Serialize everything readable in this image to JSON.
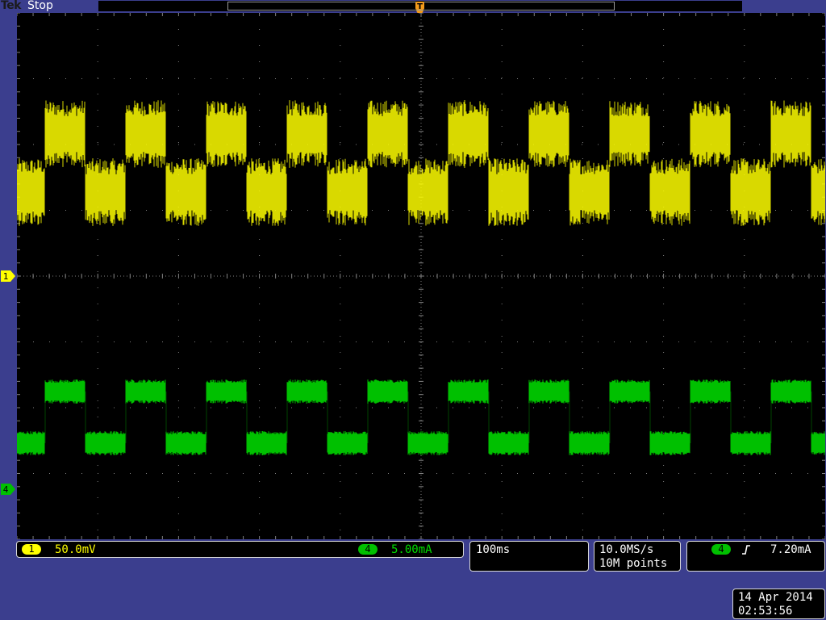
{
  "header": {
    "brand": "Tek",
    "run_status": "Stop",
    "trigger_position_marker": "T"
  },
  "channel_markers": [
    {
      "label": "1",
      "color": "#ffff00"
    },
    {
      "label": "4",
      "color": "#00c000"
    }
  ],
  "vertical_settings": {
    "ch1": {
      "badge": "1",
      "scale": "50.0mV",
      "color": "#ffff00"
    },
    "ch4": {
      "badge": "4",
      "scale": "5.00mA",
      "color": "#00c000"
    }
  },
  "horizontal": {
    "timebase": "100ms"
  },
  "acquisition": {
    "sample_rate": "10.0MS/s",
    "record_length": "10M points"
  },
  "trigger": {
    "source": "4",
    "slope_icon": "rising-edge-icon",
    "level": "7.20mA"
  },
  "datetime": {
    "date": "14 Apr 2014",
    "time": "02:53:56"
  },
  "colors": {
    "background": "#3b3e8e",
    "screen": "#000000",
    "grid": "#808080",
    "ch1": "#ffff00",
    "ch4": "#00c000"
  }
}
